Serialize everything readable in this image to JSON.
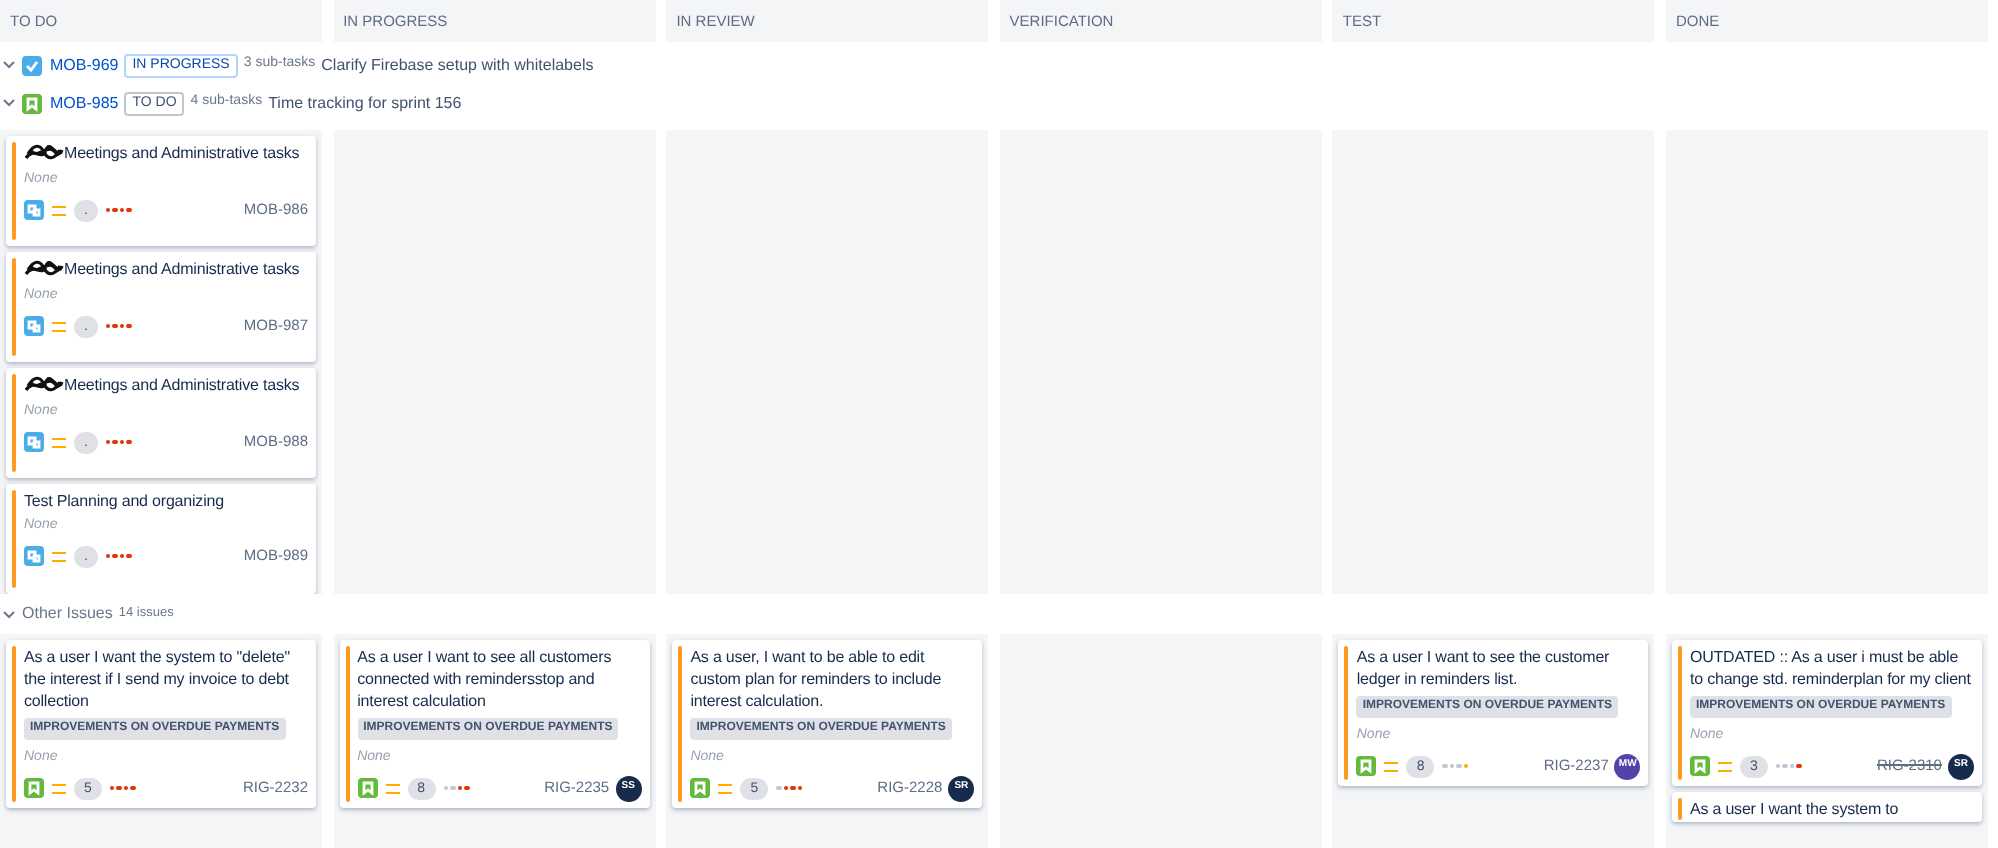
{
  "swimlanes": [
    {
      "key": "MOB-969",
      "kind": "task",
      "status": {
        "text": "IN PROGRESS",
        "kind": "progress"
      },
      "subtasks": "3 sub-tasks",
      "summary": "Clarify Firebase setup with whitelabels",
      "expanded": true
    },
    {
      "key": "MOB-985",
      "kind": "story",
      "status": {
        "text": "TO DO",
        "kind": "todo"
      },
      "subtasks": "4 sub-tasks",
      "summary": "Time tracking for sprint 156",
      "expanded": true
    }
  ],
  "other": {
    "label": "Other Issues",
    "count": "14 issues",
    "expanded": true
  },
  "columns": [
    {
      "title": "TO DO",
      "lane_cards": [
        {
          "kind": "subtask",
          "scribbled": true,
          "summary": "Meetings and Administrative tasks",
          "note": "None",
          "points": ".",
          "dots": [
            {
              "color": "#de350b"
            },
            {
              "color": "#de350b"
            },
            {
              "color": "#de350b"
            },
            {
              "color": "#de350b"
            }
          ],
          "key": "MOB-986",
          "done": false
        },
        {
          "kind": "subtask",
          "scribbled": true,
          "summary": "Meetings and Administrative tasks",
          "note": "None",
          "points": ".",
          "dots": [
            {
              "color": "#de350b"
            },
            {
              "color": "#de350b"
            },
            {
              "color": "#de350b"
            },
            {
              "color": "#de350b"
            }
          ],
          "key": "MOB-987",
          "done": false
        },
        {
          "kind": "subtask",
          "scribbled": true,
          "summary": "Meetings and Administrative tasks",
          "note": "None",
          "points": ".",
          "dots": [
            {
              "color": "#de350b"
            },
            {
              "color": "#de350b"
            },
            {
              "color": "#de350b"
            },
            {
              "color": "#de350b"
            }
          ],
          "key": "MOB-988",
          "done": false
        },
        {
          "kind": "subtask",
          "scribbled": false,
          "summary": "Test Planning and organizing",
          "note": "None",
          "points": ".",
          "dots": [
            {
              "color": "#de350b"
            },
            {
              "color": "#de350b"
            },
            {
              "color": "#de350b"
            },
            {
              "color": "#de350b"
            }
          ],
          "key": "MOB-989",
          "done": false
        }
      ],
      "other_cards": [
        {
          "kind": "story",
          "summary": "As a user I want the system to \"delete\" the interest if I send my invoice to debt collection",
          "epic": "IMPROVEMENTS ON OVERDUE PAYMENTS",
          "note": "None",
          "points": "5",
          "dots": [
            {
              "color": "#de350b"
            },
            {
              "color": "#de350b"
            },
            {
              "color": "#de350b"
            },
            {
              "color": "#de350b"
            }
          ],
          "key": "RIG-2232",
          "done": false
        }
      ]
    },
    {
      "title": "IN PROGRESS",
      "other_cards": [
        {
          "kind": "story",
          "summary": "As a user I want to see all customers connected with remindersstop and interest calculation",
          "epic": "IMPROVEMENTS ON OVERDUE PAYMENTS",
          "note": "None",
          "points": "8",
          "dots": [
            {
              "color": "#c1c7d0"
            },
            {
              "color": "#c1c7d0"
            },
            {
              "color": "#de350b"
            },
            {
              "color": "#de350b"
            }
          ],
          "key": "RIG-2235",
          "done": false,
          "avatar": {
            "text": "SS",
            "color": "#172b4d"
          }
        }
      ]
    },
    {
      "title": "IN REVIEW",
      "other_cards": [
        {
          "kind": "story",
          "summary": "As a user, I want to be able to edit custom plan for reminders to include interest calculation.",
          "epic": "IMPROVEMENTS ON OVERDUE PAYMENTS",
          "note": "None",
          "points": "5",
          "dots": [
            {
              "color": "#c1c7d0"
            },
            {
              "color": "#de350b"
            },
            {
              "color": "#de350b"
            },
            {
              "color": "#de350b"
            }
          ],
          "key": "RIG-2228",
          "done": false,
          "avatar": {
            "text": "SR",
            "color": "#172b4d"
          }
        }
      ]
    },
    {
      "title": "VERIFICATION"
    },
    {
      "title": "TEST",
      "other_cards": [
        {
          "kind": "story",
          "summary": "As a user I want to see the customer ledger in reminders list.",
          "epic": "IMPROVEMENTS ON OVERDUE PAYMENTS",
          "note": "None",
          "points": "8",
          "dots": [
            {
              "color": "#c1c7d0"
            },
            {
              "color": "#c1c7d0"
            },
            {
              "color": "#c1c7d0"
            },
            {
              "color": "#ffab00"
            }
          ],
          "key": "RIG-2237",
          "done": false,
          "avatar": {
            "text": "MW",
            "color": "#5243aa"
          }
        }
      ]
    },
    {
      "title": "DONE",
      "other_cards": [
        {
          "kind": "story",
          "summary": "OUTDATED :: As a user i must be able to change std. reminderplan for my client",
          "epic": "IMPROVEMENTS ON OVERDUE PAYMENTS",
          "note": "None",
          "points": "3",
          "dots": [
            {
              "color": "#c1c7d0"
            },
            {
              "color": "#c1c7d0"
            },
            {
              "color": "#c1c7d0"
            },
            {
              "color": "#de350b"
            }
          ],
          "key": "RIG-2310",
          "done": true,
          "avatar": {
            "text": "SR",
            "color": "#172b4d"
          }
        },
        {
          "kind": "partial",
          "summary": "As a user I want the system to"
        }
      ]
    }
  ]
}
